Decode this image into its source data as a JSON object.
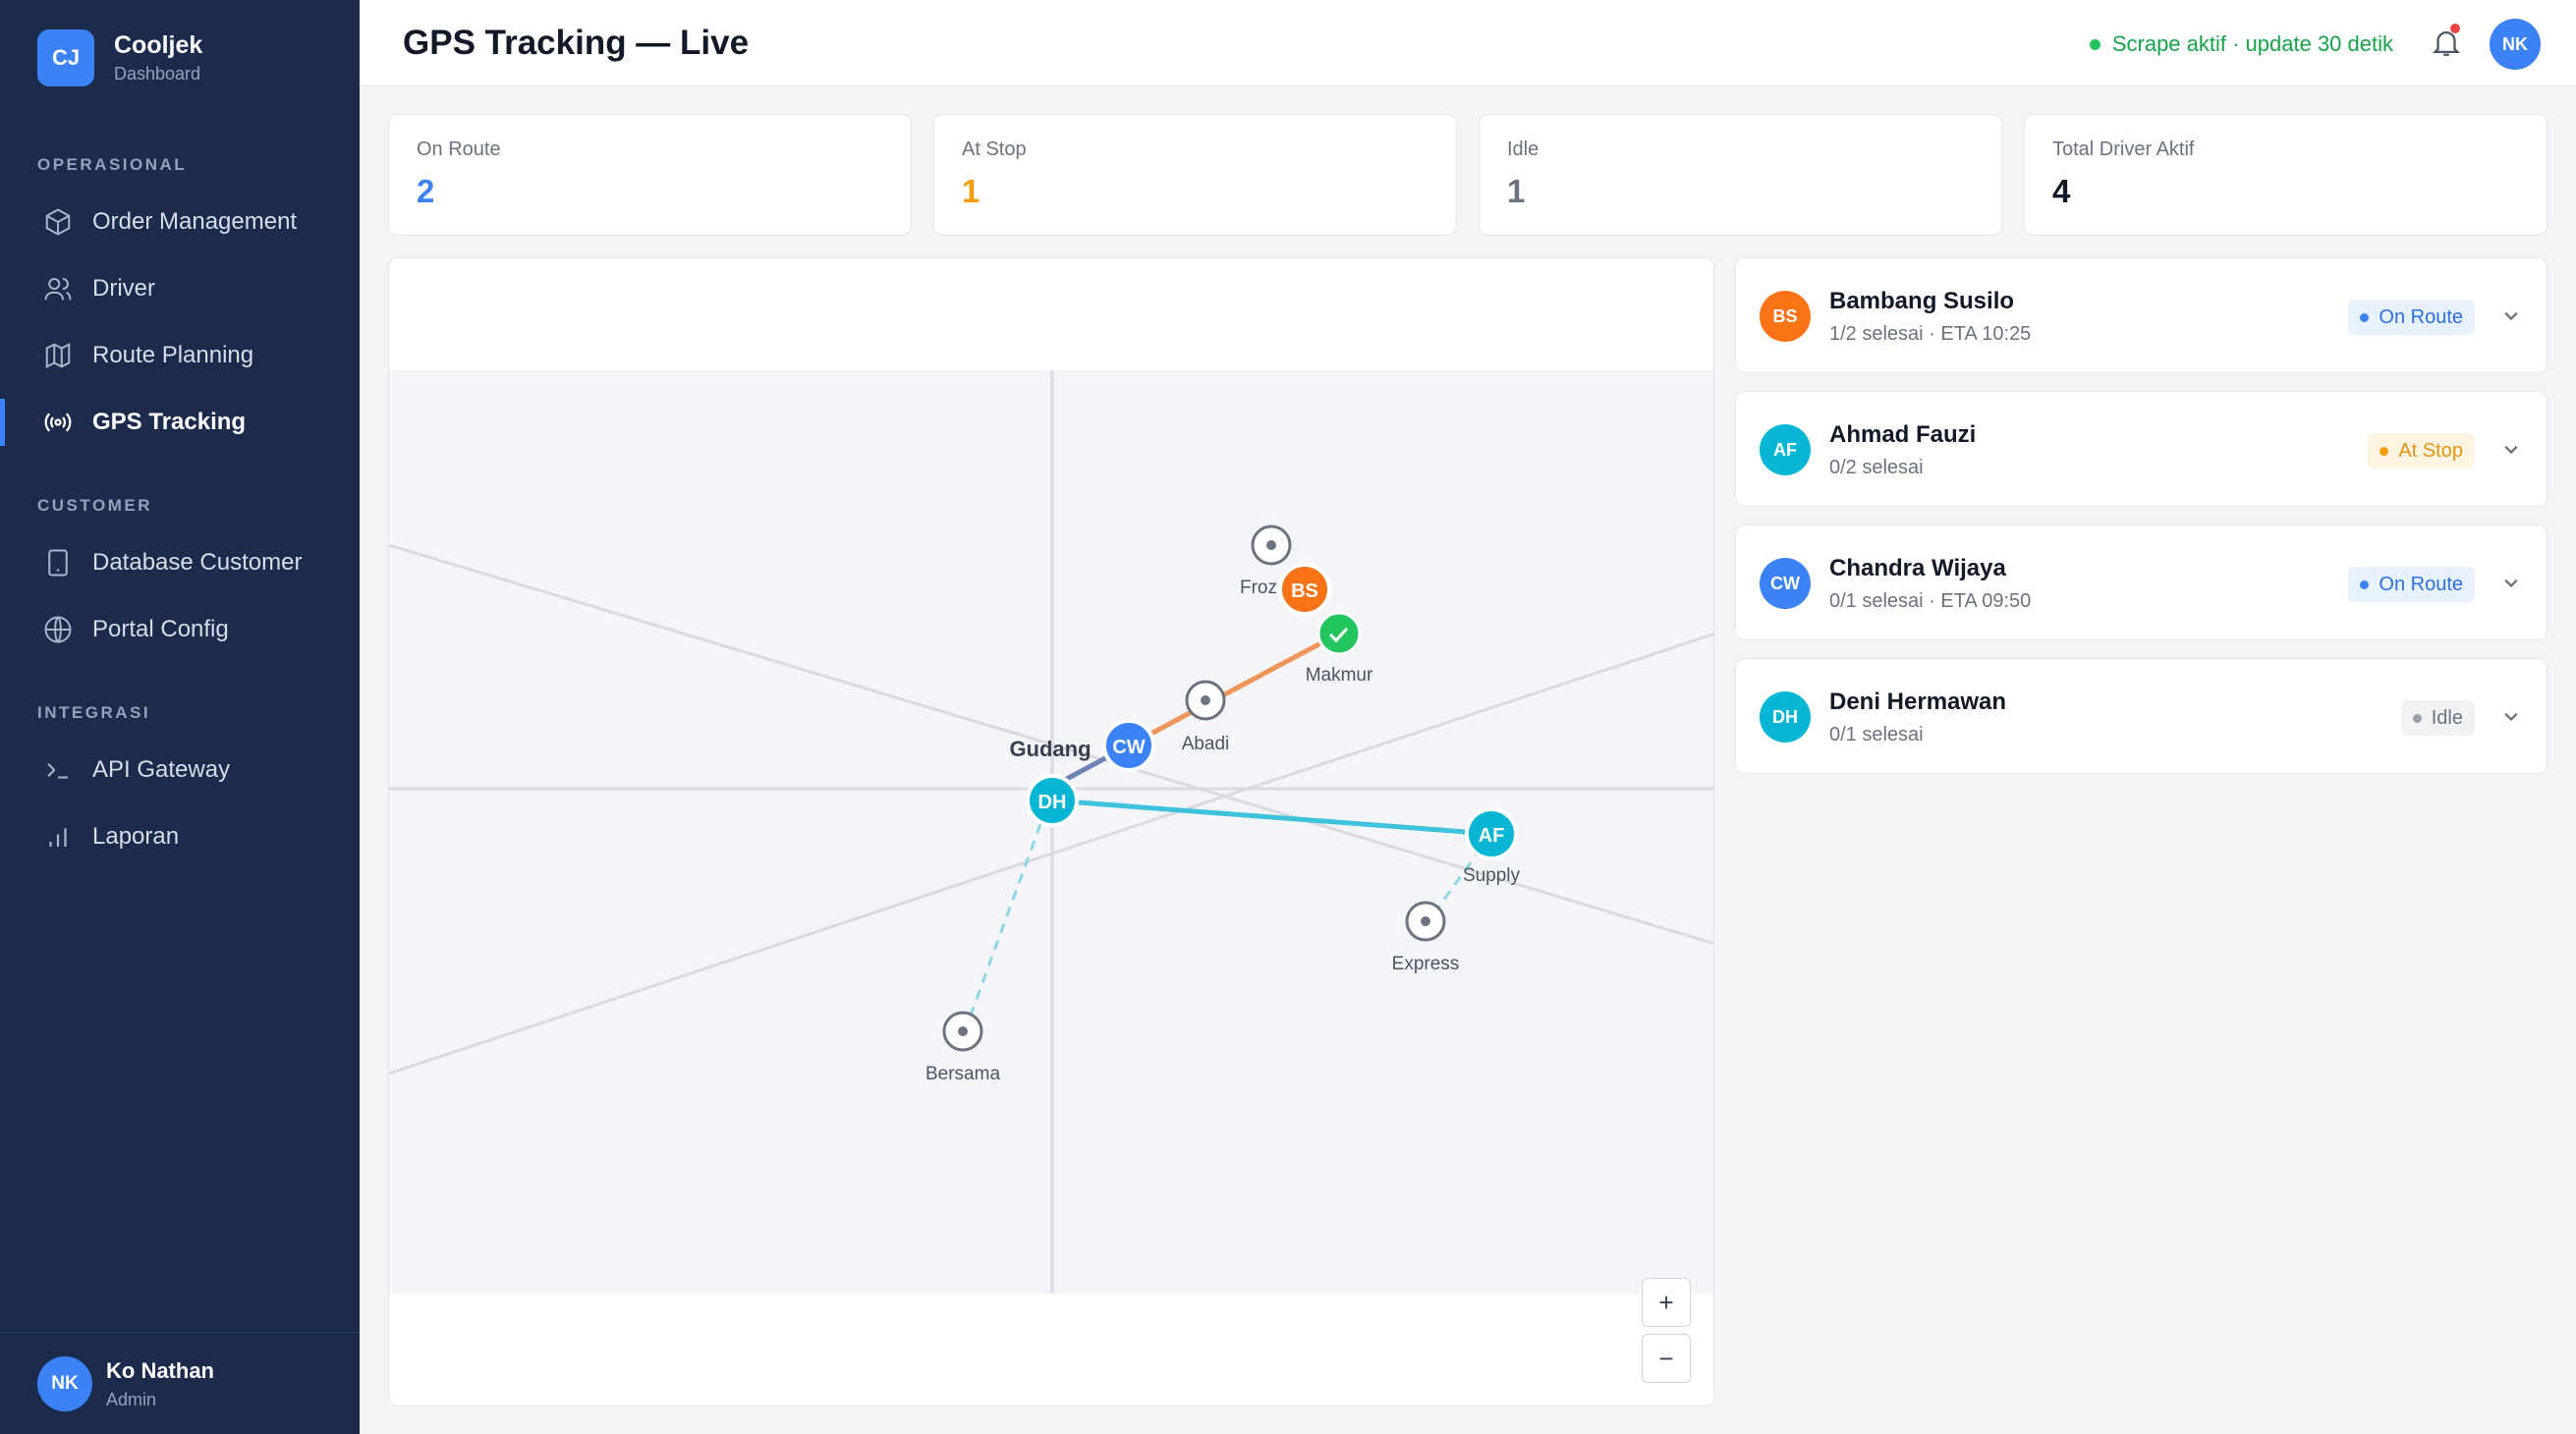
{
  "brand": {
    "initials": "CJ",
    "name": "Cooljek",
    "sub": "Dashboard"
  },
  "nav": {
    "section_ops": "OPERASIONAL",
    "section_customer": "CUSTOMER",
    "section_integrasi": "INTEGRASI",
    "items": [
      {
        "label": "Order Management",
        "icon": "box-icon"
      },
      {
        "label": "Driver",
        "icon": "users-icon"
      },
      {
        "label": "Route Planning",
        "icon": "map-icon"
      },
      {
        "label": "GPS Tracking",
        "icon": "broadcast-icon",
        "active": true
      },
      {
        "label": "Database Customer",
        "icon": "tablet-icon"
      },
      {
        "label": "Portal Config",
        "icon": "globe-icon"
      },
      {
        "label": "API Gateway",
        "icon": "terminal-icon"
      },
      {
        "label": "Laporan",
        "icon": "bar-chart-icon"
      }
    ]
  },
  "user": {
    "initials": "NK",
    "name": "Ko Nathan",
    "role": "Admin"
  },
  "header": {
    "title": "GPS Tracking — Live",
    "status": "Scrape aktif · update 30 detik",
    "avatar": "NK"
  },
  "stats": [
    {
      "label": "On Route",
      "value": "2",
      "color": "#3b82f6"
    },
    {
      "label": "At Stop",
      "value": "1",
      "color": "#f59e0b"
    },
    {
      "label": "Idle",
      "value": "1",
      "color": "#6b7280"
    },
    {
      "label": "Total Driver Aktif",
      "value": "4",
      "color": "#111827"
    }
  ],
  "map": {
    "labels": {
      "gudang": "Gudang",
      "froz": "Froz",
      "makmur": "Makmur",
      "abadi": "Abadi",
      "supply": "Supply",
      "express": "Express",
      "bersama": "Bersama"
    },
    "markers": {
      "bs": "BS",
      "cw": "CW",
      "dh": "DH",
      "af": "AF"
    },
    "zoom_in": "+",
    "zoom_out": "−"
  },
  "drivers": [
    {
      "initials": "BS",
      "name": "Bambang Susilo",
      "sub": "1/2 selesai · ETA 10:25",
      "status": "On Route",
      "color": "#f97316"
    },
    {
      "initials": "AF",
      "name": "Ahmad Fauzi",
      "sub": "0/2 selesai",
      "status": "At Stop",
      "color": "#06b6d4"
    },
    {
      "initials": "CW",
      "name": "Chandra Wijaya",
      "sub": "0/1 selesai · ETA 09:50",
      "status": "On Route",
      "color": "#3b82f6"
    },
    {
      "initials": "DH",
      "name": "Deni Hermawan",
      "sub": "0/1 selesai",
      "status": "Idle",
      "color": "#06b6d4"
    }
  ]
}
